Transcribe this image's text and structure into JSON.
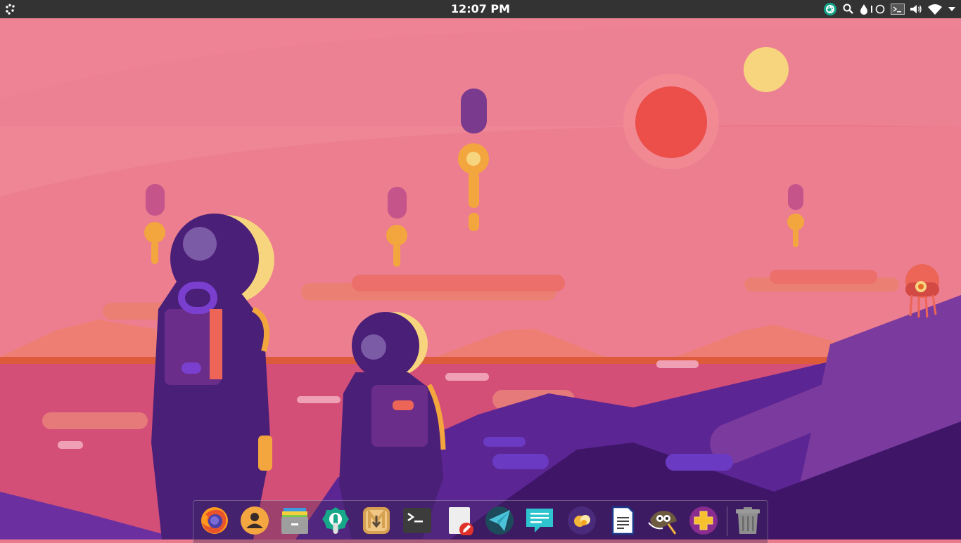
{
  "topbar": {
    "apps_icon": "applications-icon",
    "clock": "12:07 PM",
    "tray": [
      "shutter-icon",
      "search-icon",
      "night-light-icon",
      "terminal-indicator-icon",
      "volume-icon",
      "wifi-icon",
      "menu-arrow-icon"
    ]
  },
  "dock": {
    "apps": [
      "firefox",
      "contacts",
      "file-manager",
      "software-manager",
      "download-manager",
      "terminal",
      "text-editor",
      "telegram",
      "chat",
      "photo-viewer",
      "document-writer",
      "gimp",
      "add-app"
    ],
    "trash": "trash"
  },
  "colors": {
    "topbar": "#333333",
    "sky": "#ea7b8e",
    "sun": "#ec4e4a",
    "moon": "#f7d57e",
    "purple": "#4a1f78"
  }
}
